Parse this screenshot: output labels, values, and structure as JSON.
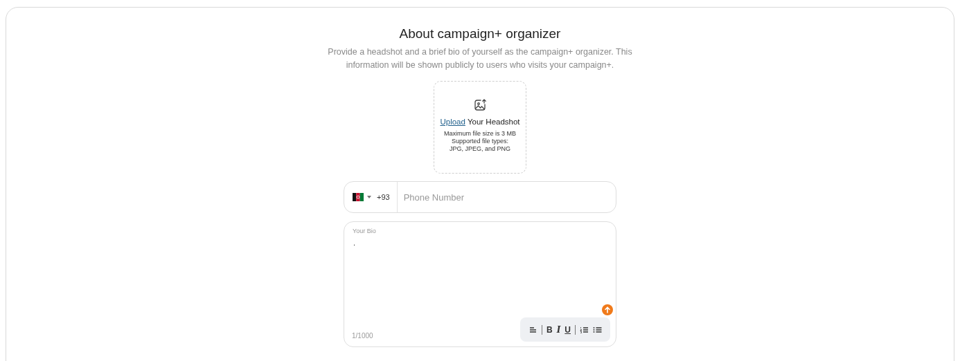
{
  "title": "About campaign+ organizer",
  "description": "Provide a headshot and a brief bio of yourself as the campaign+ organizer. This information will be shown publicly to users who visits your campaign+.",
  "upload": {
    "link": "Upload",
    "label": "Your Headshot",
    "notes": [
      "Maximum file size is 3 MB",
      "Supported file types:",
      "JPG, JPEG, and PNG"
    ]
  },
  "phone": {
    "dial_code": "+93",
    "placeholder": "Phone Number"
  },
  "bio": {
    "label": "Your Bio",
    "value": ".",
    "counter": "1/1000"
  },
  "toolbar": [
    {
      "kind": "align"
    },
    {
      "kind": "divider"
    },
    {
      "kind": "bold",
      "label": "B"
    },
    {
      "kind": "italic",
      "label": "I"
    },
    {
      "kind": "underline",
      "label": "U"
    },
    {
      "kind": "divider"
    },
    {
      "kind": "ordered"
    },
    {
      "kind": "bullets"
    }
  ]
}
